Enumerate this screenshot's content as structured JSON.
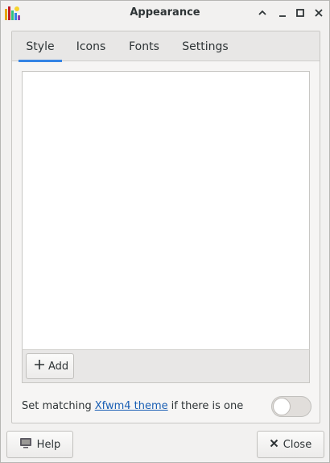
{
  "window": {
    "title": "Appearance"
  },
  "titlebar_buttons": [
    "chevron-up-icon",
    "minimize-icon",
    "maximize-icon",
    "close-icon"
  ],
  "tabs": [
    {
      "label": "Style",
      "active": true
    },
    {
      "label": "Icons",
      "active": false
    },
    {
      "label": "Fonts",
      "active": false
    },
    {
      "label": "Settings",
      "active": false
    }
  ],
  "list": {
    "items": [],
    "add_label": "Add"
  },
  "matching": {
    "prefix": "Set matching",
    "link": "Xfwm4 theme",
    "suffix": "if there is one",
    "enabled": false
  },
  "footer": {
    "help_label": "Help",
    "close_label": "Close"
  },
  "colors": {
    "accent": "#3584e4",
    "link": "#1a5fb4"
  }
}
